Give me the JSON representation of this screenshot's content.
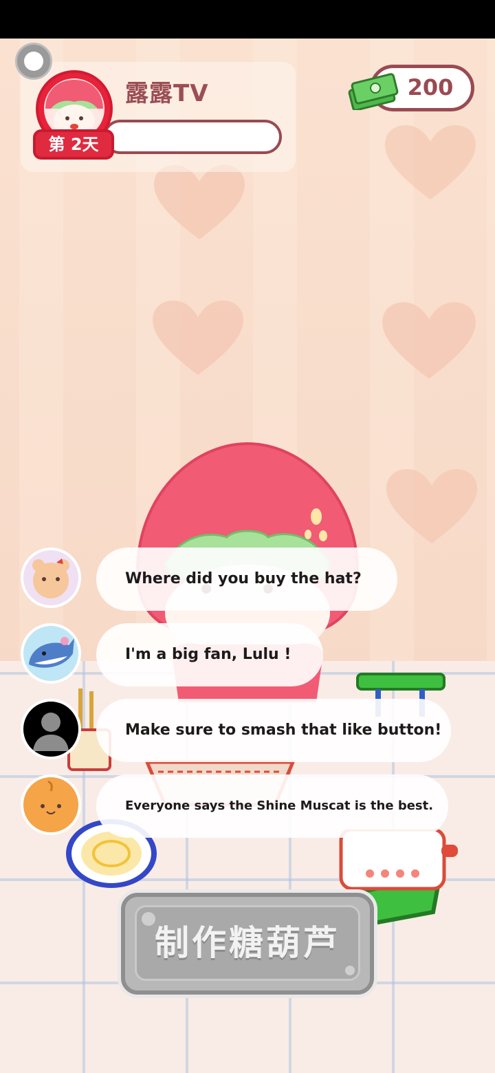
{
  "header": {
    "streamer_name": "露露TV",
    "day_label": "第 2天",
    "progress": 0.0,
    "money": "200"
  },
  "chat": [
    {
      "text": "Where did you buy the hat?"
    },
    {
      "text": "I'm a big fan, Lulu !"
    },
    {
      "text": "Make sure to smash that like button!"
    },
    {
      "text": "Everyone says the Shine Muscat is the best."
    }
  ],
  "actions": {
    "make_button_label": "制作糖葫芦"
  },
  "colors": {
    "accent_red": "#e02a3f",
    "text_brown": "#9a4a52",
    "disabled_gray": "#a9a9a9"
  }
}
